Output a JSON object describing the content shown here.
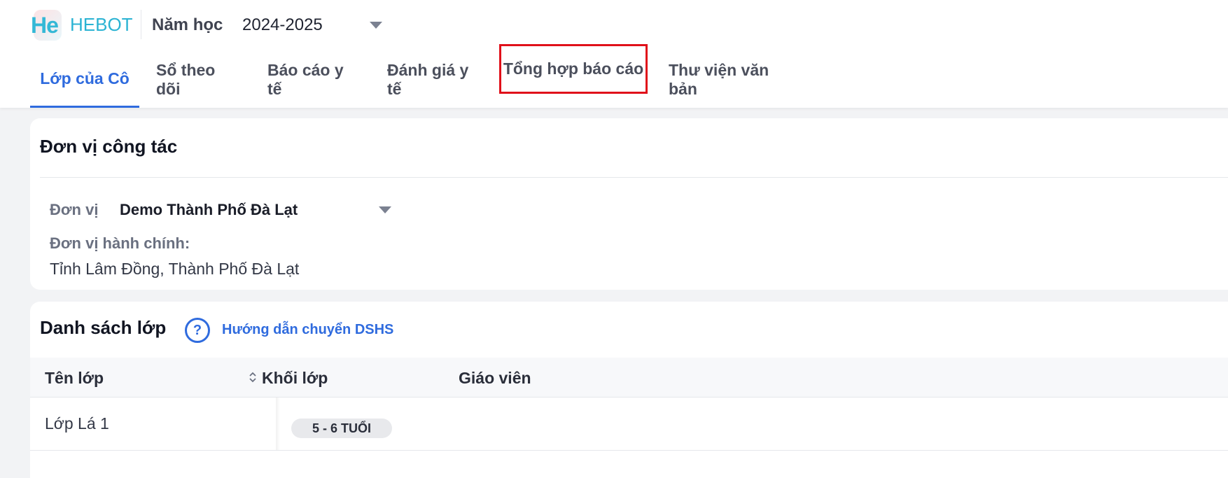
{
  "header": {
    "logo_text": "He",
    "brand": "HEBOT",
    "year_label": "Năm học",
    "year_value": "2024-2025"
  },
  "tabs": [
    {
      "label": "Lớp của Cô",
      "active": true
    },
    {
      "label": "Sổ theo dõi",
      "active": false
    },
    {
      "label": "Báo cáo y tế",
      "active": false
    },
    {
      "label": "Đánh giá y tế",
      "active": false
    },
    {
      "label": "Tổng hợp báo cáo",
      "active": false,
      "highlighted": true
    },
    {
      "label": "Thư viện văn bản",
      "active": false
    }
  ],
  "work_unit": {
    "title": "Đơn vị công tác",
    "unit_label": "Đơn vị",
    "unit_value": "Demo Thành Phố Đà Lạt",
    "admin_label": "Đơn vị hành chính:",
    "admin_value": "Tỉnh Lâm Đồng, Thành Phố Đà Lạt"
  },
  "class_list": {
    "title": "Danh sách lớp",
    "help_icon": "?",
    "help_link": "Hướng dẫn chuyển DSHS",
    "columns": [
      "Tên lớp",
      "Khối lớp",
      "Giáo viên"
    ],
    "rows": [
      {
        "name": "Lớp Lá 1",
        "grade": "5 - 6 TUỔI",
        "teacher": ""
      }
    ]
  },
  "colors": {
    "accent": "#2f6bde",
    "brand": "#2bb3d3",
    "highlight_box": "#e0101a"
  }
}
